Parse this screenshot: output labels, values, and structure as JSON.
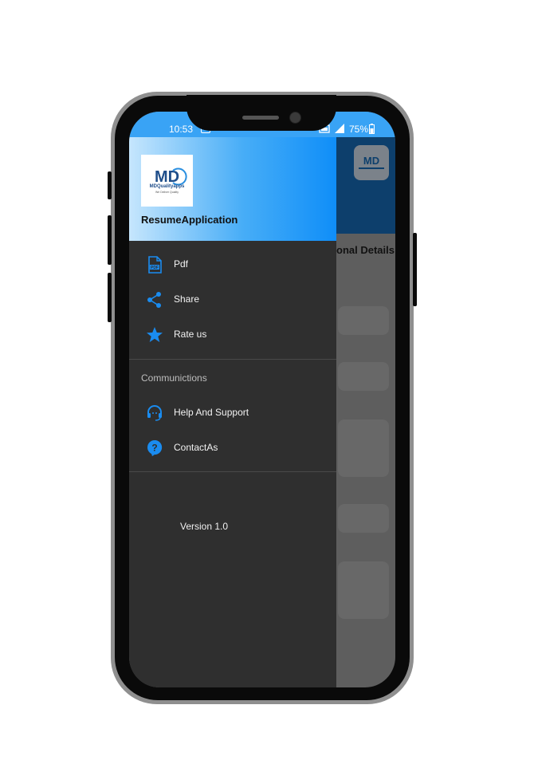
{
  "status_bar": {
    "time": "10:53",
    "battery": "75%"
  },
  "background_screen": {
    "section_title": "onal Details"
  },
  "drawer": {
    "logo_text": "MDQualityapps",
    "logo_tagline": "We Deliver Quality",
    "app_name": "ResumeApplication",
    "items": [
      {
        "label": "Pdf",
        "icon": "pdf-file-icon"
      },
      {
        "label": "Share",
        "icon": "share-icon"
      },
      {
        "label": "Rate us",
        "icon": "star-icon"
      }
    ],
    "section_label": "Communictions",
    "comm_items": [
      {
        "label": "Help And Support",
        "icon": "support-headset-icon"
      },
      {
        "label": "ContactAs",
        "icon": "help-bubble-icon"
      }
    ],
    "version": "Version  1.0"
  },
  "colors": {
    "accent": "#1a8cf0",
    "drawer_bg": "#2f2f2f",
    "header_dark": "#0d3f6c"
  }
}
